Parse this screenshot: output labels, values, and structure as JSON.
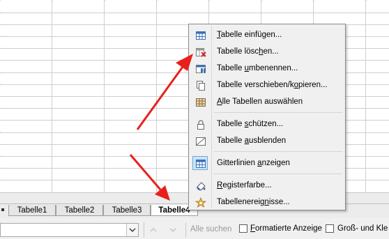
{
  "sheet_tabs": {
    "tabs": [
      {
        "label": "Tabelle1"
      },
      {
        "label": "Tabelle2"
      },
      {
        "label": "Tabelle3"
      },
      {
        "label": "Tabelle4",
        "active": true
      }
    ]
  },
  "context_menu": {
    "items": [
      {
        "pre": "",
        "u": "T",
        "post": "abelle einfügen...",
        "icon": "insert-sheet-icon"
      },
      {
        "pre": "Tabelle lösc",
        "u": "h",
        "post": "en...",
        "icon": "delete-sheet-icon"
      },
      {
        "pre": "Tabelle ",
        "u": "u",
        "post": "mbenennen...",
        "icon": "rename-sheet-icon"
      },
      {
        "pre": "Tabelle verschieben/k",
        "u": "o",
        "post": "pieren...",
        "icon": "copy-sheet-icon"
      },
      {
        "pre": "",
        "u": "A",
        "post": "lle Tabellen auswählen",
        "icon": "select-all-sheets-icon"
      },
      {
        "pre": "Tabelle ",
        "u": "s",
        "post": "chützen...",
        "icon": "lock-icon"
      },
      {
        "pre": "Tabelle ",
        "u": "a",
        "post": "usblenden",
        "icon": "hide-sheet-icon"
      },
      {
        "pre": "Gitterlinien ",
        "u": "a",
        "post": "nzeigen",
        "icon": "gridlines-icon",
        "checked": true
      },
      {
        "pre": "",
        "u": "R",
        "post": "egisterfarbe...",
        "icon": "tab-color-icon"
      },
      {
        "pre": "Tabellenereig",
        "u": "n",
        "post": "isse...",
        "icon": "sheet-events-icon"
      }
    ]
  },
  "find_toolbar": {
    "search_value": "",
    "all_search_label": "Alle suchen",
    "formatted_label": "Formatierte Anzeige",
    "formatted_underline": "F",
    "formatted_rest": "ormatierte Anzeige",
    "case_label": "Groß- und Kle",
    "formatted_checked": false,
    "case_checked": false
  },
  "colors": {
    "annotation_arrow": "#e8201c",
    "menu_highlight": "#cce4f7",
    "icon_blue": "#3b6fb6"
  }
}
